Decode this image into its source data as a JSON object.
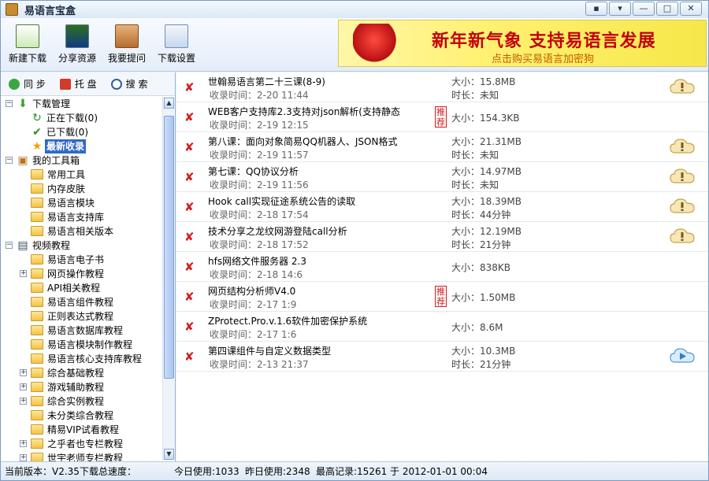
{
  "window": {
    "title": "易语言宝盒"
  },
  "toolbar": [
    {
      "label": "新建下载",
      "icon": "new-download-icon"
    },
    {
      "label": "分享资源",
      "icon": "share-resource-icon"
    },
    {
      "label": "我要提问",
      "icon": "ask-question-icon"
    },
    {
      "label": "下载设置",
      "icon": "download-settings-icon"
    }
  ],
  "ad": {
    "line1": "新年新气象 支持易语言发展",
    "line2": "点击购买易语言加密狗"
  },
  "tabs": [
    {
      "label": "同 步"
    },
    {
      "label": "托 盘"
    },
    {
      "label": "搜 索"
    }
  ],
  "tree": [
    {
      "label": "下载管理",
      "level": 0,
      "expander": "−",
      "icon": "download-manage-icon"
    },
    {
      "label": "正在下载(0)",
      "level": 1,
      "icon": "downloading-icon"
    },
    {
      "label": "已下载(0)",
      "level": 1,
      "icon": "downloaded-icon"
    },
    {
      "label": "最新收录",
      "level": 1,
      "icon": "star-icon",
      "selected": true
    },
    {
      "label": "我的工具箱",
      "level": 0,
      "expander": "−",
      "icon": "toolbox-icon"
    },
    {
      "label": "常用工具",
      "level": 1,
      "icon": "folder-icon"
    },
    {
      "label": "内存皮肤",
      "level": 1,
      "icon": "folder-icon"
    },
    {
      "label": "易语言模块",
      "level": 1,
      "icon": "folder-icon"
    },
    {
      "label": "易语言支持库",
      "level": 1,
      "icon": "folder-icon"
    },
    {
      "label": "易语言相关版本",
      "level": 1,
      "icon": "folder-icon"
    },
    {
      "label": "视频教程",
      "level": 0,
      "expander": "−",
      "icon": "video-icon"
    },
    {
      "label": "易语言电子书",
      "level": 1,
      "icon": "folder-icon"
    },
    {
      "label": "网页操作教程",
      "level": 1,
      "icon": "folder-icon",
      "expander": "+"
    },
    {
      "label": "API相关教程",
      "level": 1,
      "icon": "folder-icon"
    },
    {
      "label": "易语言组件教程",
      "level": 1,
      "icon": "folder-icon"
    },
    {
      "label": "正则表达式教程",
      "level": 1,
      "icon": "folder-icon"
    },
    {
      "label": "易语言数据库教程",
      "level": 1,
      "icon": "folder-icon"
    },
    {
      "label": "易语言模块制作教程",
      "level": 1,
      "icon": "folder-icon"
    },
    {
      "label": "易语言核心支持库教程",
      "level": 1,
      "icon": "folder-icon"
    },
    {
      "label": "综合基础教程",
      "level": 1,
      "icon": "folder-icon",
      "expander": "+"
    },
    {
      "label": "游戏辅助教程",
      "level": 1,
      "icon": "folder-icon",
      "expander": "+"
    },
    {
      "label": "综合实例教程",
      "level": 1,
      "icon": "folder-icon",
      "expander": "+"
    },
    {
      "label": "未分类综合教程",
      "level": 1,
      "icon": "folder-icon"
    },
    {
      "label": "精易VIP试看教程",
      "level": 1,
      "icon": "folder-icon"
    },
    {
      "label": "之乎者也专栏教程",
      "level": 1,
      "icon": "folder-icon",
      "expander": "+"
    },
    {
      "label": "世宇老师专栏教程",
      "level": 1,
      "icon": "folder-icon",
      "expander": "+"
    }
  ],
  "items": [
    {
      "title": "世翰易语言第二十三课(8-9)",
      "time": "收录时间：2-20 11:44",
      "size": "大小：15.8MB",
      "duration": "时长：未知",
      "recommended": false,
      "action": "cloud-download-icon"
    },
    {
      "title": "WEB客户支持库2.3支持对json解析(支持静态",
      "time": "收录时间：2-19 12:15",
      "size": "大小：154.3KB",
      "duration": "",
      "recommended": true,
      "action": ""
    },
    {
      "title": "第八课：面向对象简易QQ机器人、JSON格式",
      "time": "收录时间：2-19 11:57",
      "size": "大小：21.31MB",
      "duration": "时长：未知",
      "recommended": false,
      "action": "cloud-download-icon"
    },
    {
      "title": "第七课：QQ协议分析",
      "time": "收录时间：2-19 11:56",
      "size": "大小：14.97MB",
      "duration": "时长：未知",
      "recommended": false,
      "action": "cloud-download-icon"
    },
    {
      "title": "Hook call实现征途系统公告的读取",
      "time": "收录时间：2-18 17:54",
      "size": "大小：18.39MB",
      "duration": "时长：44分钟",
      "recommended": false,
      "action": "cloud-download-icon"
    },
    {
      "title": "技术分享之龙纹网游登陆call分析",
      "time": "收录时间：2-18 17:52",
      "size": "大小：12.19MB",
      "duration": "时长：21分钟",
      "recommended": false,
      "action": "cloud-download-icon"
    },
    {
      "title": "hfs网络文件服务器 2.3",
      "time": "收录时间：2-18 14:6",
      "size": "大小：838KB",
      "duration": "",
      "recommended": false,
      "action": ""
    },
    {
      "title": "网页结构分析师V4.0",
      "time": "收录时间：2-17 1:9",
      "size": "大小：1.50MB",
      "duration": "",
      "recommended": true,
      "action": ""
    },
    {
      "title": "ZProtect.Pro.v.1.6软件加密保护系统",
      "time": "收录时间：2-17 1:6",
      "size": "大小：8.6M",
      "duration": "",
      "recommended": false,
      "action": ""
    },
    {
      "title": "第四课组件与自定义数据类型",
      "time": "收录时间：2-13 21:37",
      "size": "大小：10.3MB",
      "duration": "时长：21分钟",
      "recommended": false,
      "action": "cloud-play-icon"
    }
  ],
  "badge_text": "推荐",
  "status": {
    "version": "当前版本：V2.35",
    "speed": "下载总速度：",
    "today": "今日使用:1033",
    "yesterday": "昨日使用:2348",
    "record": "最高记录:15261 于 2012-01-01 00:04"
  },
  "colors": {
    "accent": "#3169c6",
    "delete": "#d31d1d",
    "badge": "#d02020",
    "ad_text": "#c3000c"
  }
}
